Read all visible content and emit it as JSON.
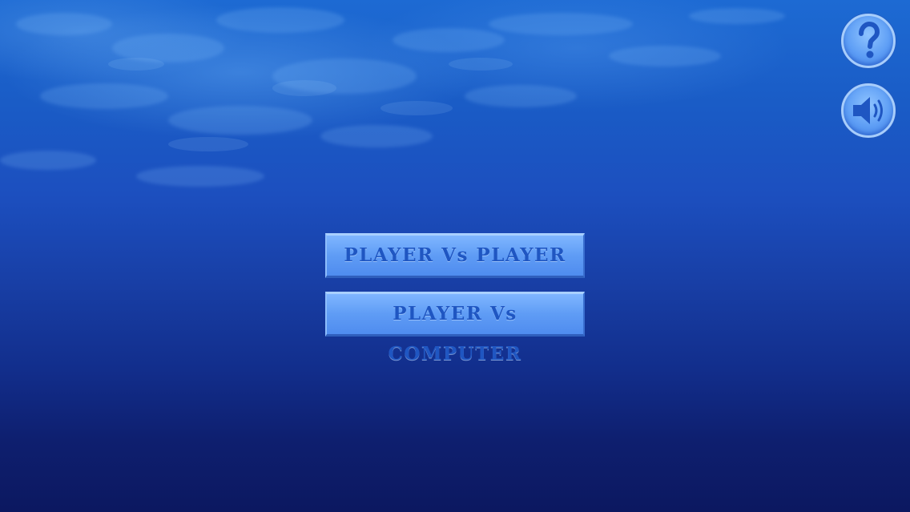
{
  "menu": {
    "pvp_label": "PLAYER Vs PLAYER",
    "pvc_label": "PLAYER Vs COMPUTER"
  },
  "controls": {
    "help_icon": "question-mark-icon",
    "sound_icon": "speaker-volume-icon"
  },
  "colors": {
    "button_fill": "#5f9cf5",
    "button_text": "#1f56c2",
    "icon_color": "#1f56c2"
  }
}
